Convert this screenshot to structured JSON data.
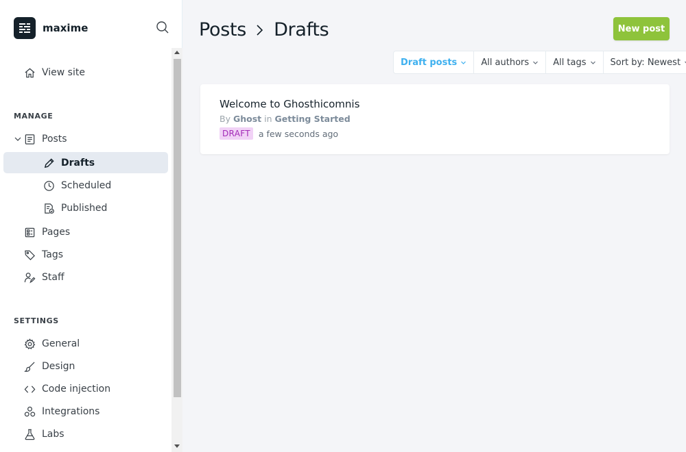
{
  "brand": {
    "name": "maxime"
  },
  "nav": {
    "view_site": "View site",
    "manage_label": "MANAGE",
    "posts": "Posts",
    "drafts": "Drafts",
    "scheduled": "Scheduled",
    "published": "Published",
    "pages": "Pages",
    "tags": "Tags",
    "staff": "Staff",
    "settings_label": "SETTINGS",
    "general": "General",
    "design": "Design",
    "code_injection": "Code injection",
    "integrations": "Integrations",
    "labs": "Labs"
  },
  "header": {
    "crumb_root": "Posts",
    "crumb_current": "Drafts",
    "new_post_label": "New post"
  },
  "filters": {
    "type": "Draft posts",
    "authors": "All authors",
    "tags": "All tags",
    "sort": "Sort by: Newest"
  },
  "posts": [
    {
      "title": "Welcome to Ghosthicomnis",
      "by": "By",
      "author": "Ghost",
      "in": "in",
      "tag": "Getting Started",
      "status": "DRAFT",
      "time": "a few seconds ago"
    }
  ],
  "colors": {
    "accent": "#3eb0ef",
    "primary_button": "#8ec33b",
    "draft_badge_bg": "#f1d2f6",
    "draft_badge_text": "#a32ab7",
    "active_nav_bg": "#e5eaf1"
  }
}
